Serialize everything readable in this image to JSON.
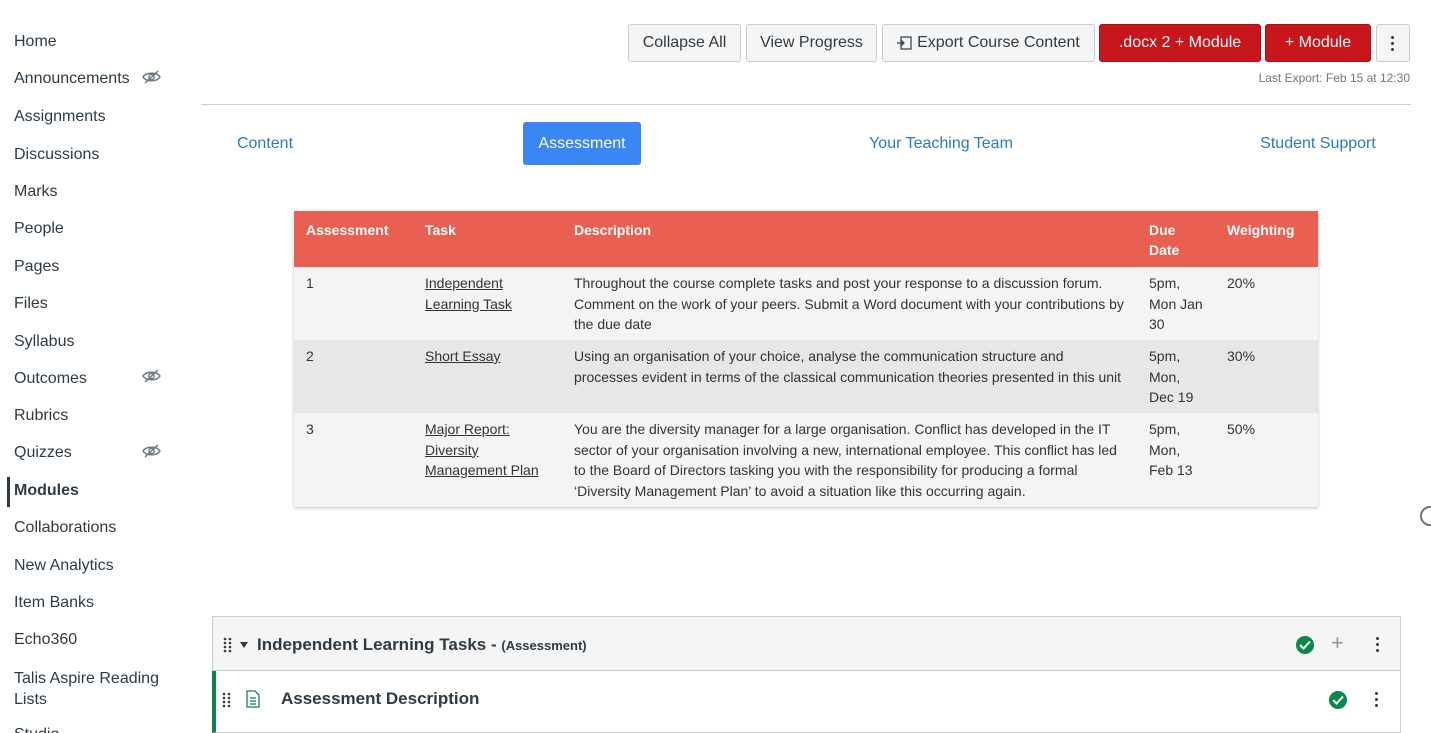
{
  "sidebar": {
    "items": [
      {
        "label": "Home",
        "hidden": false
      },
      {
        "label": "Announcements",
        "hidden": true
      },
      {
        "label": "Assignments",
        "hidden": false
      },
      {
        "label": "Discussions",
        "hidden": false
      },
      {
        "label": "Marks",
        "hidden": false
      },
      {
        "label": "People",
        "hidden": false
      },
      {
        "label": "Pages",
        "hidden": false
      },
      {
        "label": "Files",
        "hidden": false
      },
      {
        "label": "Syllabus",
        "hidden": false
      },
      {
        "label": "Outcomes",
        "hidden": true
      },
      {
        "label": "Rubrics",
        "hidden": false
      },
      {
        "label": "Quizzes",
        "hidden": true
      },
      {
        "label": "Modules",
        "hidden": false,
        "active": true
      },
      {
        "label": "Collaborations",
        "hidden": false
      },
      {
        "label": "New Analytics",
        "hidden": false
      },
      {
        "label": "Item Banks",
        "hidden": false
      },
      {
        "label": "Echo360",
        "hidden": false
      },
      {
        "label": "Talis Aspire Reading Lists",
        "hidden": false
      },
      {
        "label": "Studio",
        "hidden": false
      }
    ],
    "hidden_icon": "eye-slash-icon"
  },
  "toolbar": {
    "collapse_all": "Collapse All",
    "view_progress": "View Progress",
    "export_course_content": "Export Course Content",
    "docx_module": ".docx 2 + Module",
    "add_module": "+ Module",
    "last_export": "Last Export: Feb 15 at 12:30"
  },
  "tabs": [
    {
      "label": "Content",
      "active": false
    },
    {
      "label": "Assessment",
      "active": true
    },
    {
      "label": "Your Teaching Team",
      "active": false
    },
    {
      "label": "Student Support",
      "active": false
    }
  ],
  "assessment_table": {
    "headers": {
      "assessment": "Assessment",
      "task": "Task",
      "description": "Description",
      "due_date": "Due Date",
      "weighting": "Weighting"
    },
    "rows": [
      {
        "number": "1",
        "task": "Independent Learning Task",
        "description": "Throughout the course complete tasks and post your response to a discussion forum. Comment on the work of your peers. Submit a Word document with your contributions by the due date",
        "due": "5pm, Mon Jan 30",
        "weighting": "20%"
      },
      {
        "number": "2",
        "task": "Short Essay",
        "description": "Using an organisation of your choice, analyse the communication structure and processes evident in terms of the classical communication theories presented in this unit",
        "due": "5pm, Mon, Dec 19",
        "weighting": "30%"
      },
      {
        "number": "3",
        "task": "Major Report: Diversity Management Plan",
        "description": "You are the diversity manager for a large organisation. Conflict has developed in the IT sector of your organisation involving a new, international employee. This conflict has led to the Board of Directors tasking you with the responsibility for producing a formal ‘Diversity Management Plan’ to avoid a situation like this occurring again.",
        "due": "5pm, Mon, Feb 13",
        "weighting": "50%"
      }
    ]
  },
  "module": {
    "title": "Independent Learning Tasks -",
    "tag": "(Assessment)",
    "published": true,
    "items": [
      {
        "title": "Assessment Description",
        "published": true
      }
    ]
  },
  "colors": {
    "header_red": "#e95f51",
    "button_red": "#c8161d",
    "tab_blue": "#3a86f2",
    "link_blue": "#2b7abc",
    "publish_green": "#0b874b"
  }
}
